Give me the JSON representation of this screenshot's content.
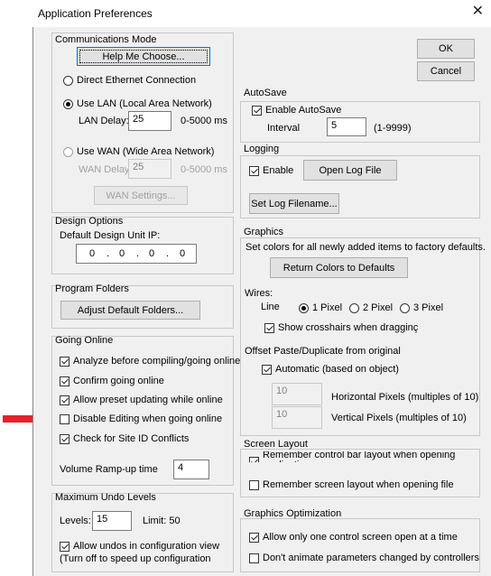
{
  "window": {
    "title": "Application Preferences",
    "close_glyph": "✕"
  },
  "buttons": {
    "ok": "OK",
    "cancel": "Cancel"
  },
  "comm": {
    "title": "Communications Mode",
    "help_btn": "Help Me Choose...",
    "direct": "Direct Ethernet Connection",
    "lan": "Use LAN (Local Area Network)",
    "lan_delay_label": "LAN Delay:",
    "lan_delay_value": "25",
    "lan_range": "0-5000 ms",
    "wan": "Use WAN (Wide Area Network)",
    "wan_delay_label": "WAN Delay:",
    "wan_delay_value": "25",
    "wan_range": "0-5000 ms",
    "wan_settings_btn": "WAN Settings..."
  },
  "design": {
    "title": "Design Options",
    "ip_label": "Default Design Unit IP:",
    "ip": [
      "0",
      "0",
      "0",
      "0"
    ],
    "dot": "."
  },
  "folders": {
    "title": "Program Folders",
    "btn": "Adjust Default Folders..."
  },
  "online": {
    "title": "Going Online",
    "items": [
      {
        "label": "Analyze before compiling/going online",
        "checked": true
      },
      {
        "label": "Confirm going online",
        "checked": true
      },
      {
        "label": "Allow preset updating while online",
        "checked": true
      },
      {
        "label": "Disable Editing when going online",
        "checked": false
      },
      {
        "label": "Check for Site ID Conflicts",
        "checked": true
      }
    ],
    "ramp_label": "Volume Ramp-up time",
    "ramp_value": "4"
  },
  "undo": {
    "title": "Maximum Undo Levels",
    "levels_label": "Levels:",
    "levels_value": "15",
    "limit": "Limit: 50",
    "allow_label": "Allow undos in configuration view",
    "allow_sub": "(Turn off to speed up configuration"
  },
  "autosave": {
    "title": "AutoSave",
    "enable": "Enable AutoSave",
    "interval_label": "Interval",
    "interval_value": "5",
    "range": "(1-9999)"
  },
  "logging": {
    "title": "Logging",
    "enable": "Enable",
    "open_btn": "Open Log File",
    "set_btn": "Set Log Filename..."
  },
  "graphics": {
    "title": "Graphics",
    "desc": "Set colors for all newly added items to factory defaults.",
    "return_btn": "Return Colors to Defaults",
    "wires_label": "Wires:",
    "line_label": "Line",
    "px1": "1 Pixel",
    "px2": "2 Pixel",
    "px3": "3 Pixel",
    "crosshairs": "Show crosshairs when dragginç",
    "offset_label": "Offset Paste/Duplicate from original",
    "automatic": "Automatic (based on object)",
    "h_value": "10",
    "h_label": "Horizontal Pixels (multiples of 10)",
    "v_value": "10",
    "v_label": "Vertical Pixels (multiples of 10)"
  },
  "screen": {
    "title": "Screen Layout",
    "remember_bar": "Remember control bar layout when opening",
    "remember_bar_cut": "application",
    "remember_layout": "Remember screen layout when opening file"
  },
  "gopt": {
    "title": "Graphics Optimization",
    "one_screen": "Allow only one control screen open at a time",
    "no_animate": "Don't animate parameters changed by controllers"
  },
  "colors": {
    "arrow": "#e8202a",
    "focus_border": "#0078d7",
    "window_bg": "#f0f0f0"
  }
}
